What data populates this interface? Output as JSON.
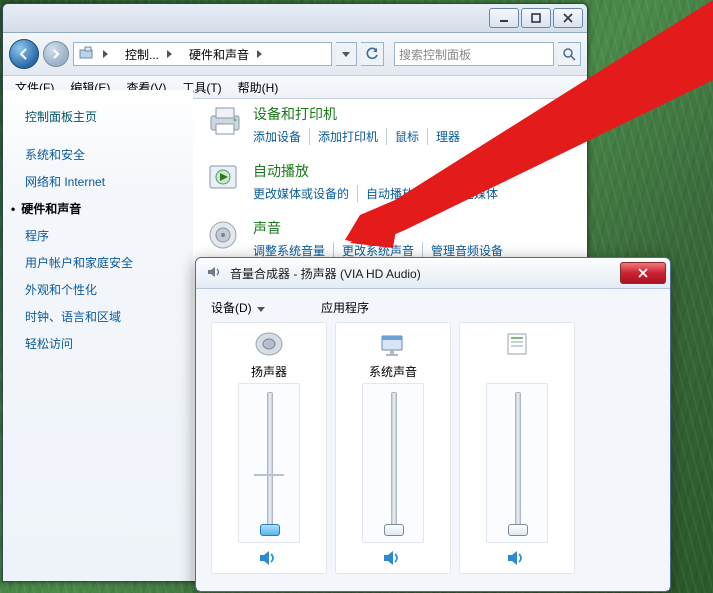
{
  "cp": {
    "breadcrumb": {
      "b1": "控制...",
      "b2": "硬件和声音"
    },
    "search_placeholder": "搜索控制面板",
    "menu": {
      "file": "文件(F)",
      "edit": "编辑(E)",
      "view": "查看(V)",
      "tools": "工具(T)",
      "help": "帮助(H)"
    },
    "sidebar": {
      "home": "控制面板主页",
      "items": [
        {
          "label": "系统和安全"
        },
        {
          "label": "网络和 Internet"
        },
        {
          "label": "硬件和声音",
          "current": true
        },
        {
          "label": "程序"
        },
        {
          "label": "用户帐户和家庭安全"
        },
        {
          "label": "外观和个性化"
        },
        {
          "label": "时钟、语言和区域"
        },
        {
          "label": "轻松访问"
        }
      ]
    },
    "cats": [
      {
        "title": "设备和打印机",
        "links": [
          "添加设备",
          "添加打印机",
          "鼠标",
          "理器"
        ]
      },
      {
        "title": "自动播放",
        "links": [
          "更改媒体或设备的",
          "自动播放 CD 或其他媒体"
        ]
      },
      {
        "title": "声音",
        "links": [
          "调整系统音量",
          "更改系统声音",
          "管理音频设备"
        ]
      }
    ]
  },
  "mixer": {
    "title": "音量合成器 - 扬声器 (VIA HD Audio)",
    "device_hdr": "设备(D)",
    "app_hdr": "应用程序",
    "strips": [
      {
        "label": "扬声器"
      },
      {
        "label": "系统声音"
      },
      {
        "label": ""
      }
    ]
  }
}
